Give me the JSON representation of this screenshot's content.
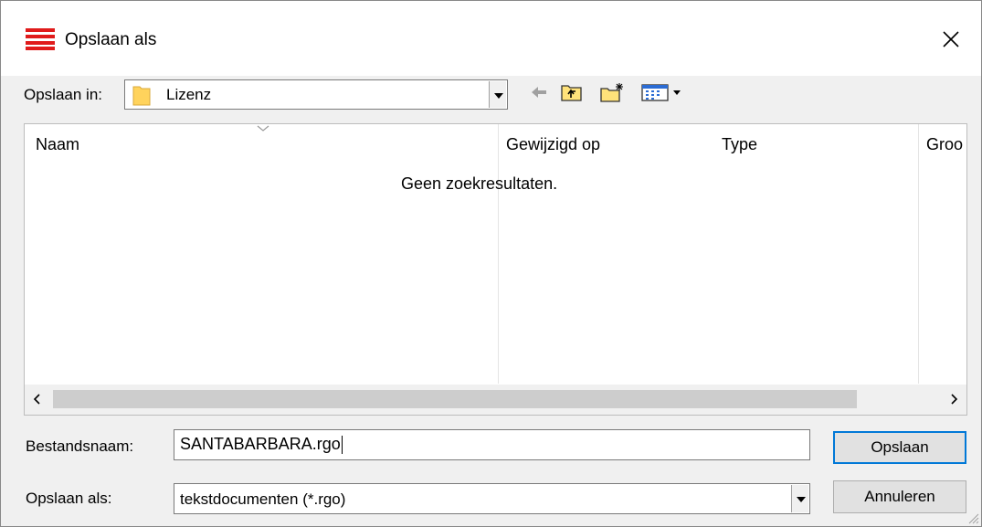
{
  "window": {
    "title": "Opslaan als",
    "close_glyph": "✕"
  },
  "location": {
    "label": "Opslaan in:",
    "value": "Lizenz",
    "icon": "folder-icon"
  },
  "toolbar": {
    "back_icon": "back-arrow-icon",
    "up_icon": "folder-up-icon",
    "new_folder_icon": "new-folder-icon",
    "view_menu_icon": "view-menu-icon"
  },
  "file_list": {
    "columns": [
      "Naam",
      "Gewijzigd op",
      "Type",
      "Groo"
    ],
    "empty_message": "Geen zoekresultaten.",
    "scroll_left": "<",
    "scroll_right": ">"
  },
  "filename": {
    "label": "Bestandsnaam:",
    "value": "SANTABARBARA.rgo"
  },
  "filetype": {
    "label": "Opslaan als:",
    "value": "tekstdocumenten (*.rgo)"
  },
  "buttons": {
    "save": "Opslaan",
    "cancel": "Annuleren"
  },
  "colors": {
    "brand_red": "#e01b1b",
    "focus_blue": "#0078d7",
    "folder_yellow": "#ffd35c"
  }
}
